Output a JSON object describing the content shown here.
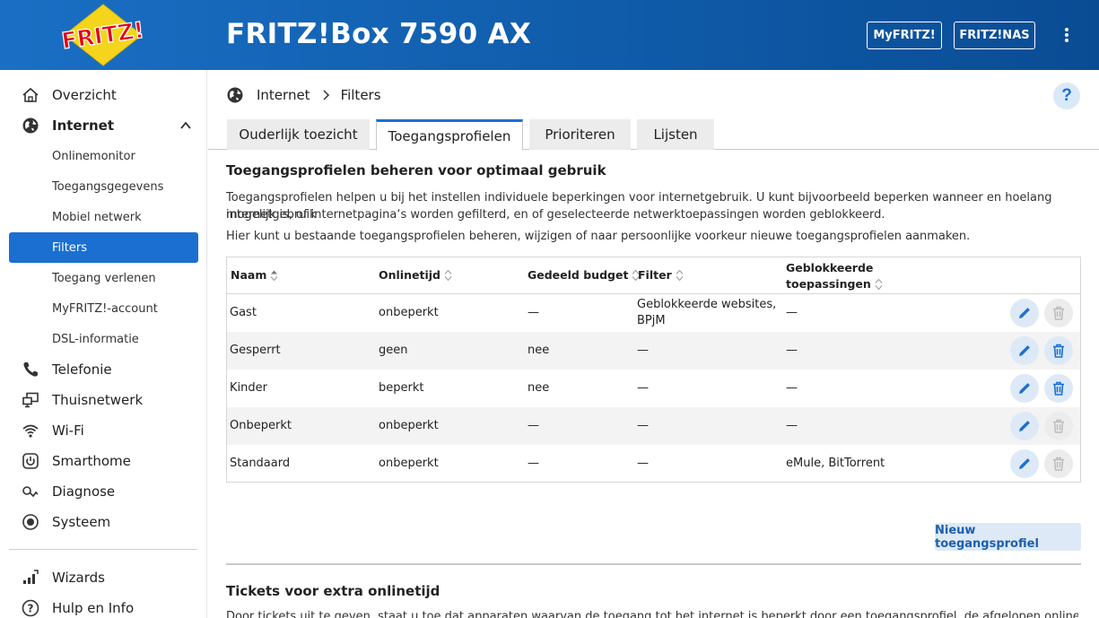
{
  "header": {
    "logo_text": "FRITZ!",
    "product_title": "FRITZ!Box 7590 AX",
    "buttons": {
      "myfritz": "MyFRITZ!",
      "fritznas": "FRITZ!NAS"
    },
    "colors": {
      "header_blue": "#1a6fc4",
      "logo_yellow": "#f5d51b",
      "logo_red": "#e2001a"
    }
  },
  "sidebar": {
    "items": [
      {
        "label": "Overzicht",
        "icon": "home-icon"
      },
      {
        "label": "Internet",
        "icon": "globe-icon",
        "expanded": true
      },
      {
        "label": "Telefonie",
        "icon": "phone-icon"
      },
      {
        "label": "Thuisnetwerk",
        "icon": "network-icon"
      },
      {
        "label": "Wi-Fi",
        "icon": "wifi-icon"
      },
      {
        "label": "Smarthome",
        "icon": "power-icon"
      },
      {
        "label": "Diagnose",
        "icon": "diagnose-icon"
      },
      {
        "label": "Systeem",
        "icon": "system-icon"
      },
      {
        "label": "Wizards",
        "icon": "wizard-icon"
      },
      {
        "label": "Hulp en Info",
        "icon": "help-icon"
      }
    ],
    "internet_sub": [
      {
        "label": "Onlinemonitor"
      },
      {
        "label": "Toegangsgegevens"
      },
      {
        "label": "Mobiel netwerk"
      },
      {
        "label": "Filters",
        "active": true
      },
      {
        "label": "Toegang verlenen"
      },
      {
        "label": "MyFRITZ!-account"
      },
      {
        "label": "DSL-informatie"
      }
    ],
    "accent": "#1b6fd1"
  },
  "breadcrumb": {
    "parent": "Internet",
    "current": "Filters"
  },
  "help_label": "?",
  "tabs": [
    {
      "label": "Ouderlijk toezicht"
    },
    {
      "label": "Toegangsprofielen",
      "active": true
    },
    {
      "label": "Prioriteren"
    },
    {
      "label": "Lijsten"
    }
  ],
  "section": {
    "title": "Toegangsprofielen beheren voor optimaal gebruik",
    "para1_line1": "Toegangsprofielen helpen u bij het instellen individuele beperkingen voor internetgebruik. U kunt bijvoorbeeld beperken wanneer en hoelang internetgebruik",
    "para1_line2": "mogelijk is, of internetpagina‘s worden gefilterd, en of geselecteerde netwerktoepassingen worden geblokkeerd.",
    "para2": "Hier kunt u bestaande toegangsprofielen beheren, wijzigen of naar persoonlijke voorkeur nieuwe toegangsprofielen aanmaken."
  },
  "table": {
    "headers": {
      "name": "Naam",
      "onlinetijd": "Onlinetijd",
      "budget": "Gedeeld budget",
      "filter": "Filter",
      "apps_line1": "Geblokkeerde",
      "apps_line2": "toepassingen"
    },
    "rows": [
      {
        "name": "Gast",
        "onlinetijd": "onbeperkt",
        "budget": "—",
        "filter_line1": "Geblokkeerde websites,",
        "filter_line2": "BPjM",
        "apps": "—",
        "delete_enabled": false
      },
      {
        "name": "Gesperrt",
        "onlinetijd": "geen",
        "budget": "nee",
        "filter_line1": "—",
        "filter_line2": "",
        "apps": "—",
        "delete_enabled": true
      },
      {
        "name": "Kinder",
        "onlinetijd": "beperkt",
        "budget": "nee",
        "filter_line1": "—",
        "filter_line2": "",
        "apps": "—",
        "delete_enabled": true
      },
      {
        "name": "Onbeperkt",
        "onlinetijd": "onbeperkt",
        "budget": "—",
        "filter_line1": "—",
        "filter_line2": "",
        "apps": "—",
        "delete_enabled": false
      },
      {
        "name": "Standaard",
        "onlinetijd": "onbeperkt",
        "budget": "—",
        "filter_line1": "—",
        "filter_line2": "",
        "apps": "eMule, BitTorrent",
        "delete_enabled": false
      }
    ]
  },
  "new_profile_button": "Nieuw toegangsprofiel",
  "tickets": {
    "title": "Tickets voor extra onlinetijd",
    "text": "Door tickets uit te geven, staat u toe dat apparaten waarvan de toegang tot het internet is beperkt door een toegangsprofiel, de afgelopen onlinetijd kunnen"
  }
}
